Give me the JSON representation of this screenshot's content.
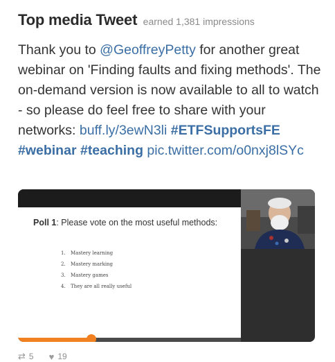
{
  "header": {
    "title": "Top media Tweet",
    "earned": "earned 1,381 impressions"
  },
  "tweet": {
    "line1_pre": "Thank you to ",
    "mention": "@GeoffreyPetty",
    "line1_post": "  for another great webinar on 'Finding faults and fixing methods'. The on-demand version is now available to all to watch - so please do feel free to share with your networks:",
    "short_link": "buff.ly/3ewN3li",
    "hashtag1": "#ETFSupportsFE",
    "hashtag2": "#webinar",
    "hashtag3": "#teaching",
    "pic_link": "pic.twitter.com/o0nxj8lSYc"
  },
  "media": {
    "poll_label": "Poll 1",
    "poll_question": ": Please vote on the most useful methods:",
    "options": [
      {
        "num": "1.",
        "text": "Mastery learning"
      },
      {
        "num": "2.",
        "text": "Mastery marking"
      },
      {
        "num": "3.",
        "text": "Mastery games"
      },
      {
        "num": "4.",
        "text": "They are all really useful"
      }
    ],
    "video_progress": 0.33,
    "accent_color": "#f08020"
  },
  "actions": {
    "retweets": "5",
    "likes": "19",
    "retweet_icon": "retweet-icon",
    "like_icon": "heart-icon"
  }
}
